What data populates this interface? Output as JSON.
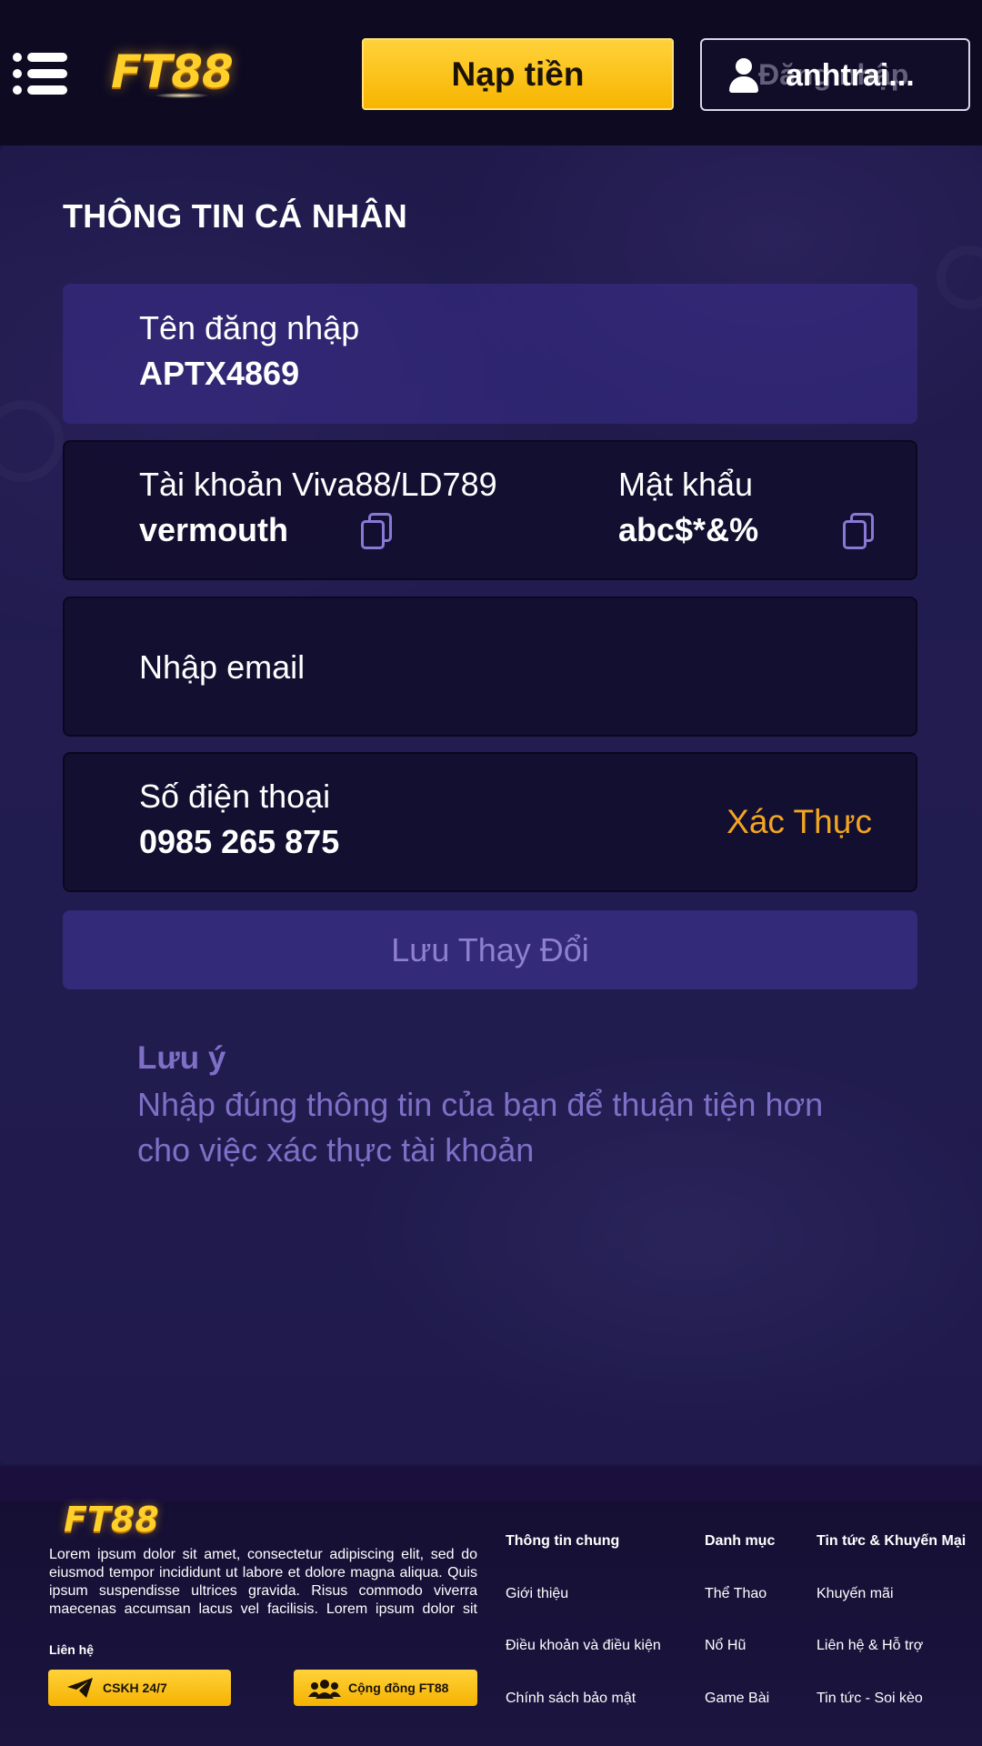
{
  "header": {
    "logo": "FT88",
    "deposit_label": "Nạp tiền",
    "login_ghost": "Đăng nhập",
    "username_display": "anhtrai..."
  },
  "profile": {
    "title": "THÔNG TIN CÁ NHÂN",
    "username_label": "Tên đăng nhập",
    "username_value": "APTX4869",
    "account_label": "Tài khoản Viva88/LD789",
    "account_value": "vermouth",
    "password_label": "Mật khẩu",
    "password_value": "abc$*&%",
    "email_placeholder": "Nhập email",
    "phone_label": "Số điện thoại",
    "phone_value": "0985 265 875",
    "verify_label": "Xác Thực",
    "save_label": "Lưu Thay Đổi",
    "note_title": "Lưu ý",
    "note_text": "Nhập đúng thông tin của bạn để thuận tiện hơn cho việc xác thực tài khoản"
  },
  "footer": {
    "logo": "FT88",
    "description": "Lorem ipsum dolor sit amet, consectetur adipiscing elit, sed do eiusmod tempor incididunt ut labore et dolore magna aliqua. Quis ipsum suspendisse ultrices gravida. Risus commodo viverra maecenas accumsan lacus vel facilisis. Lorem ipsum dolor sit amet, consectetur adipiscing elit, sed do eiusmod",
    "contact_label": "Liên hệ",
    "cskh_label": "CSKH 24/7",
    "community_label": "Cộng đồng FT88",
    "columns": [
      {
        "heading": "Thông tin chung",
        "links": [
          "Giới thiệu",
          "Điều khoản và điều kiện",
          "Chính sách bảo mật"
        ]
      },
      {
        "heading": "Danh mục",
        "links": [
          "Thể Thao",
          "Nổ Hũ",
          "Game Bài"
        ]
      },
      {
        "heading": "Tin tức & Khuyến Mại",
        "links": [
          "Khuyến mãi",
          "Liên hệ & Hỗ trợ",
          "Tin tức - Soi kèo"
        ]
      }
    ]
  },
  "colors": {
    "accent_gold": "#f7b500",
    "verify_orange": "#f3a521",
    "muted_purple": "#7e6fc7"
  }
}
